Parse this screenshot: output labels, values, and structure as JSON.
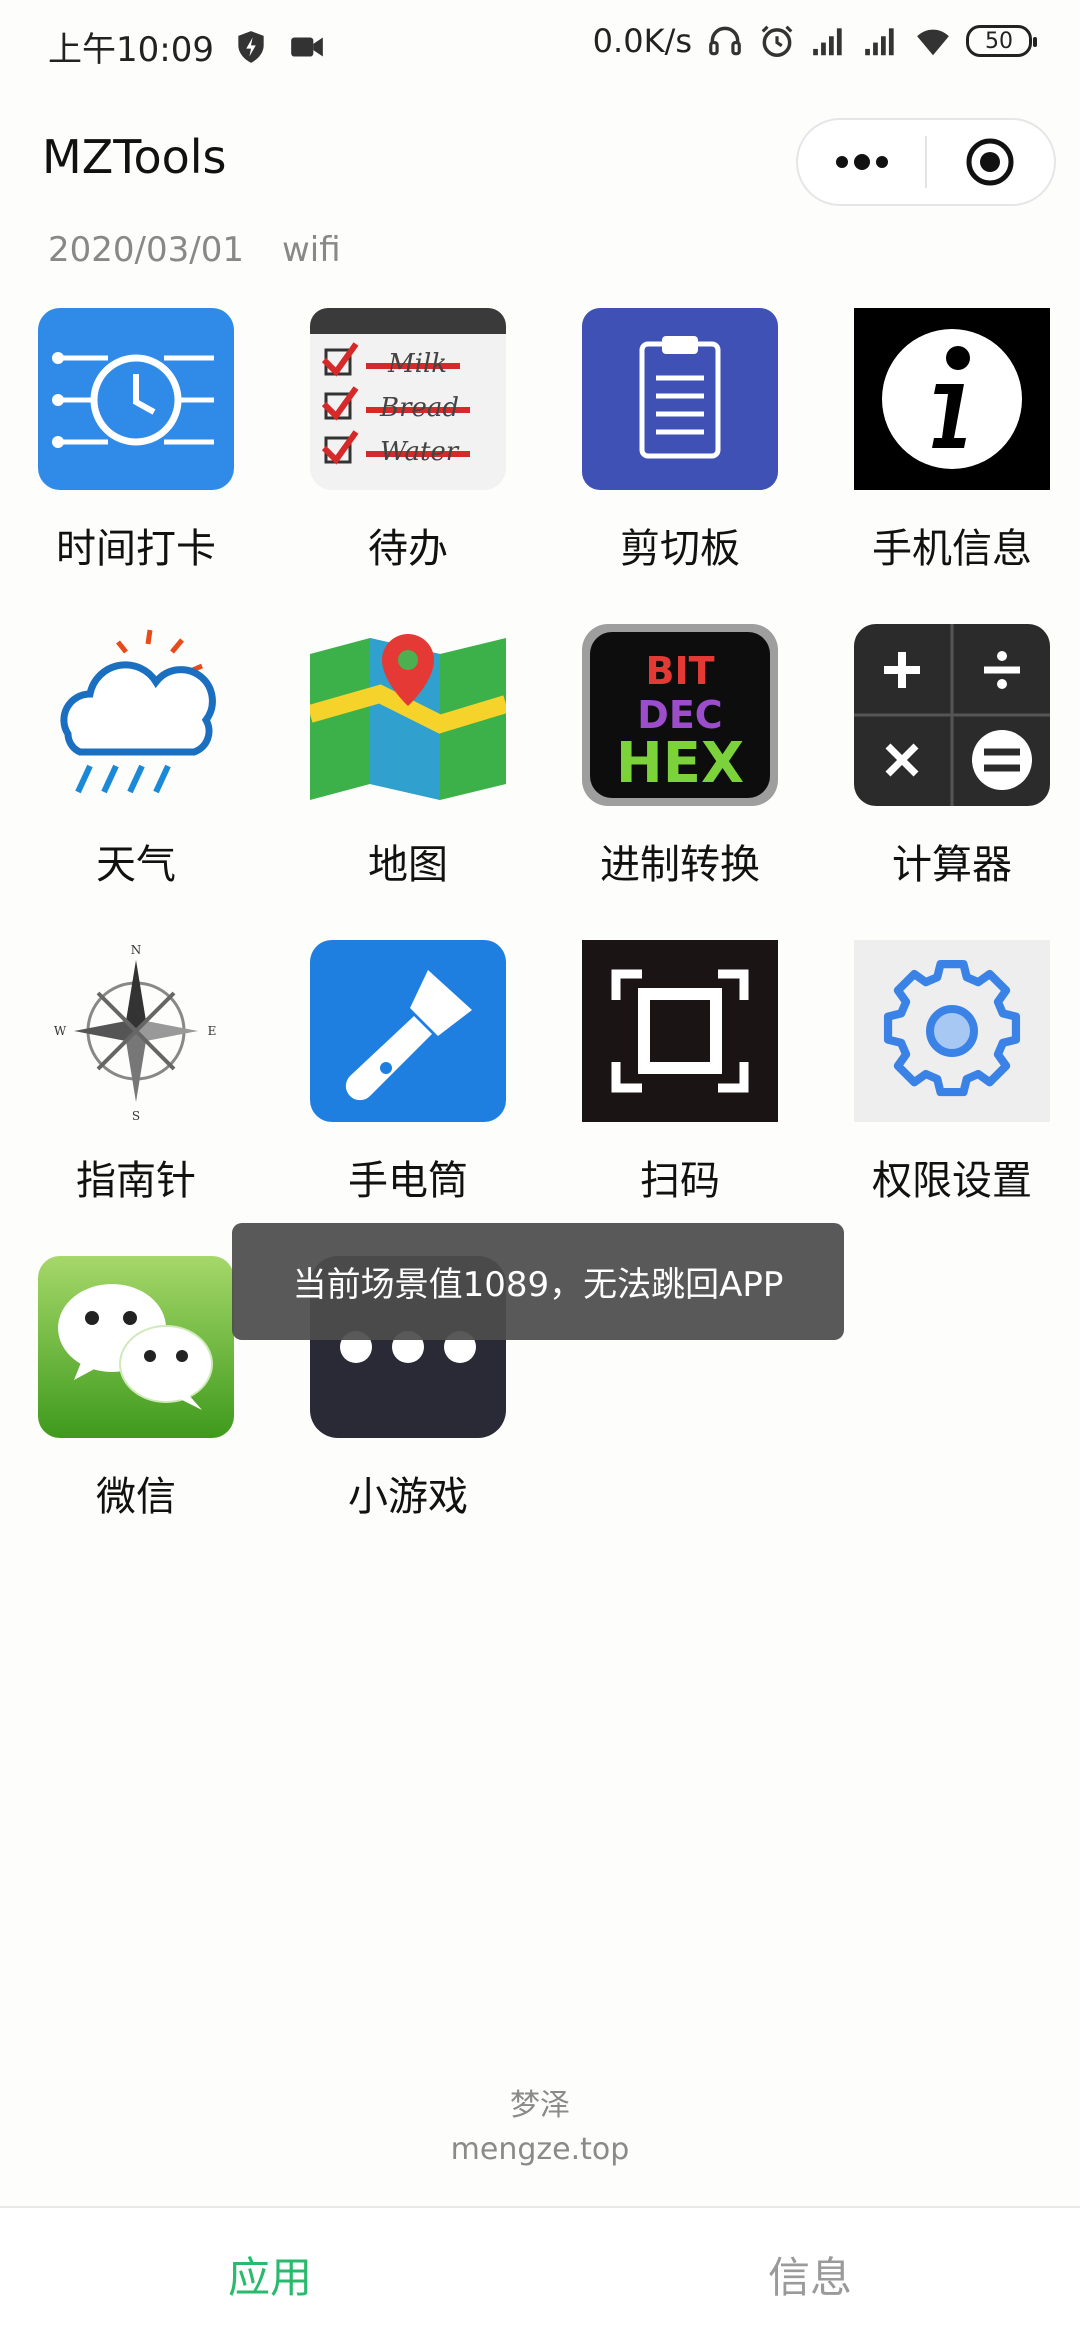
{
  "status_bar": {
    "time": "上午10:09",
    "net_speed": "0.0K/s",
    "battery": "50",
    "icons": [
      "shield-icon",
      "video-icon",
      "headphones-icon",
      "alarm-icon",
      "signal-icon",
      "signal-icon",
      "wifi-icon",
      "battery-icon"
    ]
  },
  "header": {
    "title": "MZTools",
    "date": "2020/03/01",
    "network": "wifi",
    "capsule_icons": [
      "more-icon",
      "target-icon"
    ]
  },
  "apps": [
    {
      "label": "时间打卡",
      "icon": "clock-icon"
    },
    {
      "label": "待办",
      "icon": "checklist-icon"
    },
    {
      "label": "剪切板",
      "icon": "clipboard-icon"
    },
    {
      "label": "手机信息",
      "icon": "info-icon"
    },
    {
      "label": "天气",
      "icon": "weather-icon"
    },
    {
      "label": "地图",
      "icon": "map-icon"
    },
    {
      "label": "进制转换",
      "icon": "bit-dec-hex-icon",
      "icon_text": [
        "BIT",
        "DEC",
        "HEX"
      ]
    },
    {
      "label": "计算器",
      "icon": "calculator-icon"
    },
    {
      "label": "指南针",
      "icon": "compass-icon",
      "icon_text": [
        "N",
        "S",
        "E",
        "W"
      ]
    },
    {
      "label": "手电筒",
      "icon": "flashlight-icon"
    },
    {
      "label": "扫码",
      "icon": "scan-icon"
    },
    {
      "label": "权限设置",
      "icon": "gear-icon"
    },
    {
      "label": "微信",
      "icon": "wechat-icon"
    },
    {
      "label": "小游戏",
      "icon": "more-dots-icon"
    }
  ],
  "toast": {
    "text": "当前场景值1089，无法跳回APP"
  },
  "footer": {
    "brand": "梦泽",
    "site": "mengze.top"
  },
  "tabbar": {
    "tabs": [
      {
        "label": "应用",
        "active": true
      },
      {
        "label": "信息",
        "active": false
      }
    ],
    "active_color": "#2aba6e",
    "inactive_color": "#9a9a9a"
  }
}
